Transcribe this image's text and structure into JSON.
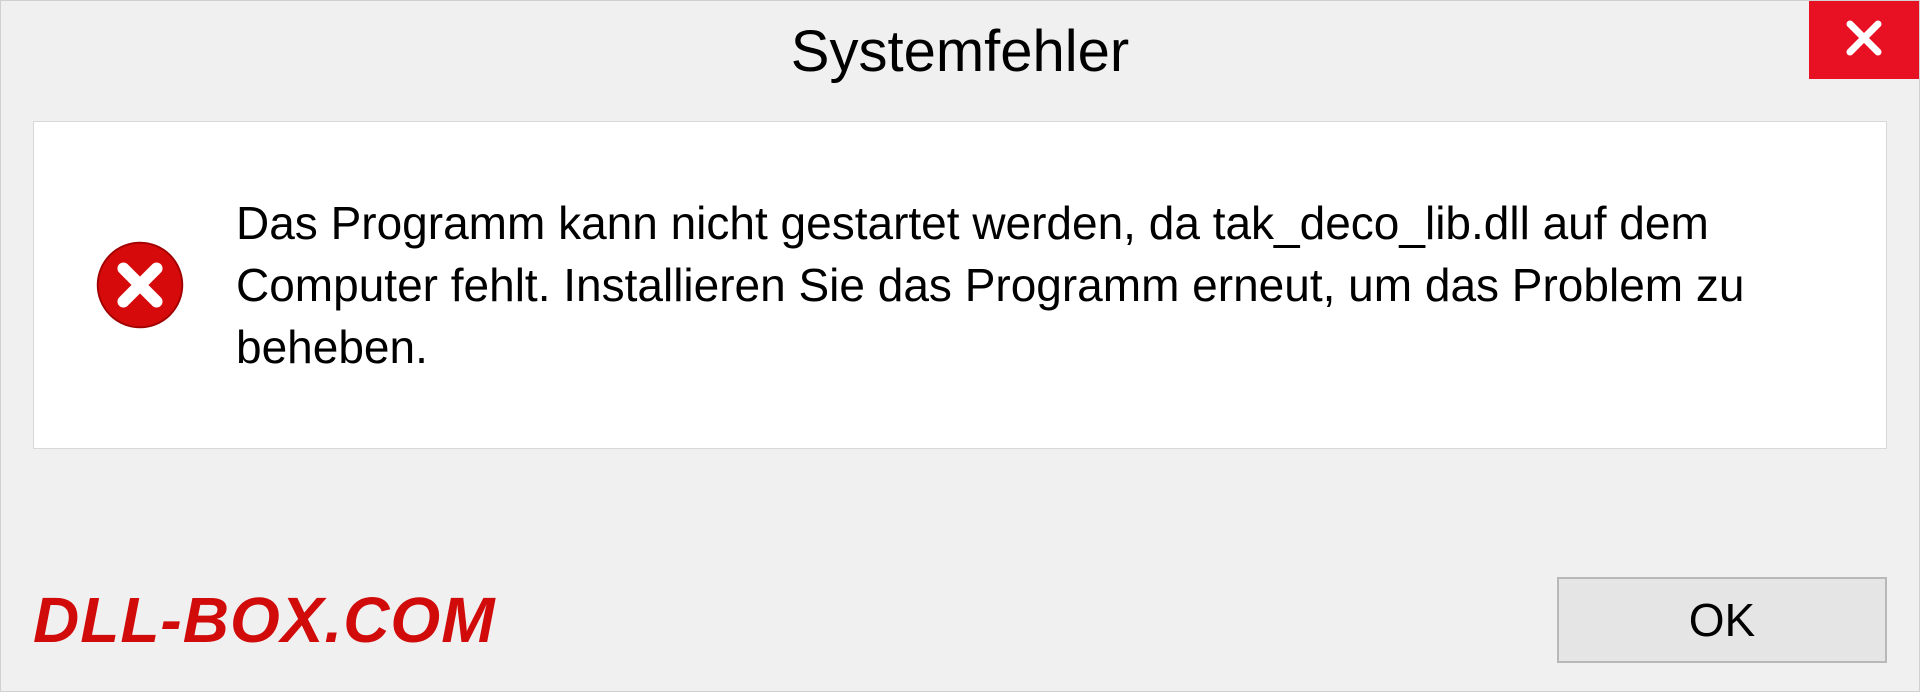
{
  "dialog": {
    "title": "Systemfehler",
    "message": "Das Programm kann nicht gestartet werden, da tak_deco_lib.dll auf dem Computer fehlt. Installieren Sie das Programm erneut, um das Problem zu beheben.",
    "ok_label": "OK"
  },
  "watermark": "DLL-BOX.COM",
  "colors": {
    "close_bg": "#e81123",
    "error_icon": "#d60a0a",
    "watermark": "#d10a0a"
  }
}
